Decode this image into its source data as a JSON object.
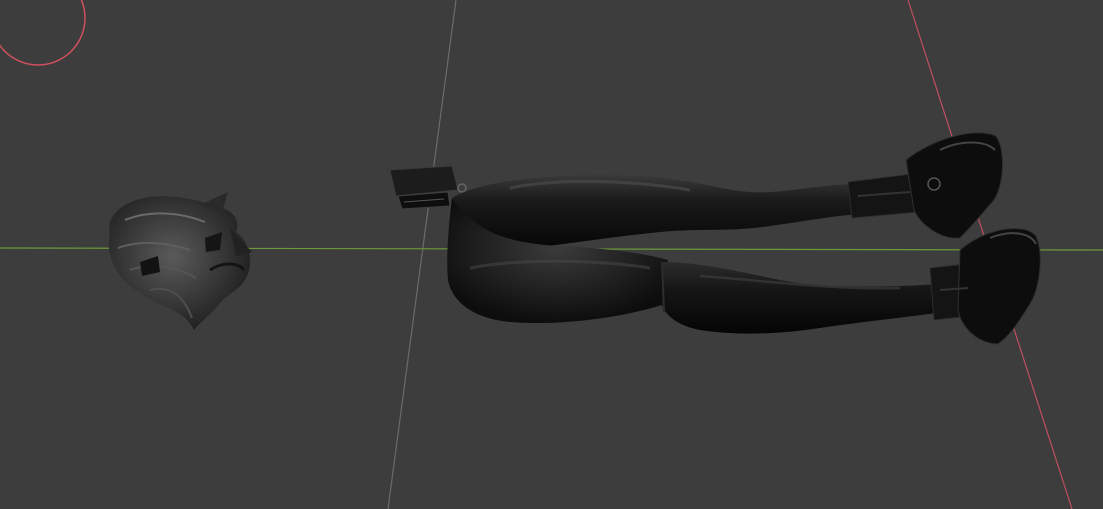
{
  "viewport": {
    "background_color": "#3d3d3d",
    "axes": {
      "x_axis_color": "#c0505f",
      "y_axis_color": "#6c9a3a",
      "z_axis_color": "#6a6a6a"
    },
    "gizmo": {
      "name": "3d-cursor",
      "color": "#d05060"
    },
    "objects": [
      {
        "name": "hair-mesh"
      },
      {
        "name": "legs-mesh"
      },
      {
        "name": "left-boot-mesh"
      },
      {
        "name": "right-boot-mesh"
      },
      {
        "name": "belt-pouch-mesh"
      }
    ]
  }
}
